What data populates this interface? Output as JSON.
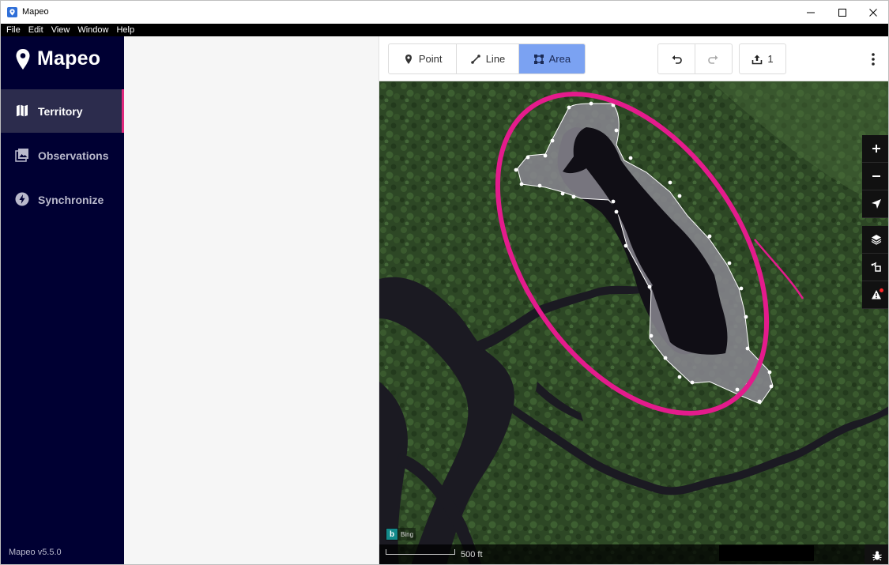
{
  "window": {
    "title": "Mapeo",
    "icons": [
      "app-icon",
      "minimize-icon",
      "maximize-icon",
      "close-icon"
    ]
  },
  "menubar": {
    "items": [
      "File",
      "Edit",
      "View",
      "Window",
      "Help"
    ]
  },
  "sidebar": {
    "brand": "Mapeo",
    "items": [
      {
        "label": "Territory",
        "icon": "map-icon",
        "active": true
      },
      {
        "label": "Observations",
        "icon": "photo-icon",
        "active": false
      },
      {
        "label": "Synchronize",
        "icon": "lightning-icon",
        "active": false
      }
    ],
    "version": "Mapeo v5.5.0"
  },
  "toolbar": {
    "modes": [
      {
        "label": "Point",
        "icon": "pin-icon",
        "active": false
      },
      {
        "label": "Line",
        "icon": "line-icon",
        "active": false
      },
      {
        "label": "Area",
        "icon": "area-icon",
        "active": true
      }
    ],
    "undo_icon": "undo-icon",
    "redo_icon": "redo-icon",
    "upload_count": "1",
    "more_icon": "more-vertical-icon"
  },
  "map": {
    "controls": [
      "zoom-in-icon",
      "zoom-out-icon",
      "geolocate-icon",
      "layers-icon",
      "node-move-icon",
      "issues-warning-icon"
    ],
    "attribution": "Bing",
    "scale_label": "500 ft",
    "debug_icon": "bug-icon",
    "colors": {
      "highlight": "#e41b8c",
      "area_fill": "#7a7880",
      "forest": "#2f4a26",
      "water": "#1a1820"
    }
  }
}
